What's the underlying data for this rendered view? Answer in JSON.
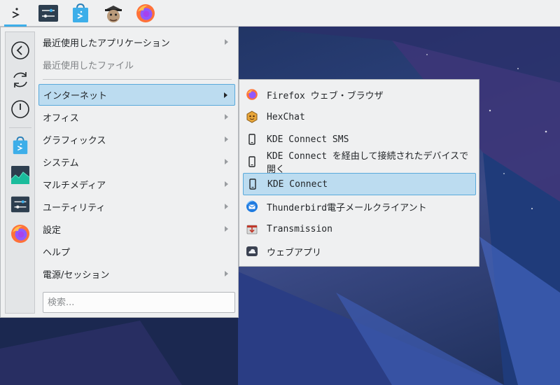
{
  "colors": {
    "accent": "#3daee9",
    "selection": "#bcdcf0",
    "panel": "#eff0f1"
  },
  "panel": {
    "tasks": [
      {
        "icon": "app-launcher-icon"
      },
      {
        "icon": "system-settings-icon"
      },
      {
        "icon": "discover-store-icon"
      },
      {
        "icon": "user-avatar-icon"
      },
      {
        "icon": "firefox-icon"
      }
    ]
  },
  "favorites": [
    {
      "icon": "back-arrow-icon"
    },
    {
      "icon": "refresh-icon"
    },
    {
      "icon": "power-icon"
    },
    {
      "icon": "discover-store-icon"
    },
    {
      "icon": "system-monitor-icon"
    },
    {
      "icon": "system-settings-icon"
    },
    {
      "icon": "firefox-icon"
    }
  ],
  "menu": {
    "items": [
      {
        "label": "最近使用したアプリケーション",
        "submenu": true
      },
      {
        "label": "最近使用したファイル",
        "submenu": false,
        "disabled": true
      },
      {
        "label": "インターネット",
        "submenu": true,
        "selected": true
      },
      {
        "label": "オフィス",
        "submenu": true
      },
      {
        "label": "グラフィックス",
        "submenu": true
      },
      {
        "label": "システム",
        "submenu": true
      },
      {
        "label": "マルチメディア",
        "submenu": true
      },
      {
        "label": "ユーティリティ",
        "submenu": true
      },
      {
        "label": "設定",
        "submenu": true
      },
      {
        "label": "ヘルプ",
        "submenu": false
      },
      {
        "label": "電源/セッション",
        "submenu": true
      }
    ],
    "search_placeholder": "検索..."
  },
  "submenu": {
    "items": [
      {
        "label": "Firefox ウェブ・ブラウザ",
        "icon": "firefox-icon"
      },
      {
        "label": "HexChat",
        "icon": "hexchat-icon"
      },
      {
        "label": "KDE Connect SMS",
        "icon": "phone-icon"
      },
      {
        "label": "KDE Connect を経由して接続されたデバイスで開く",
        "icon": "phone-icon"
      },
      {
        "label": "KDE Connect",
        "icon": "phone-icon",
        "selected": true
      },
      {
        "label": "Thunderbird電子メールクライアント",
        "icon": "thunderbird-icon"
      },
      {
        "label": "Transmission",
        "icon": "transmission-icon"
      },
      {
        "label": "ウェブアプリ",
        "icon": "web-apps-icon"
      }
    ]
  }
}
